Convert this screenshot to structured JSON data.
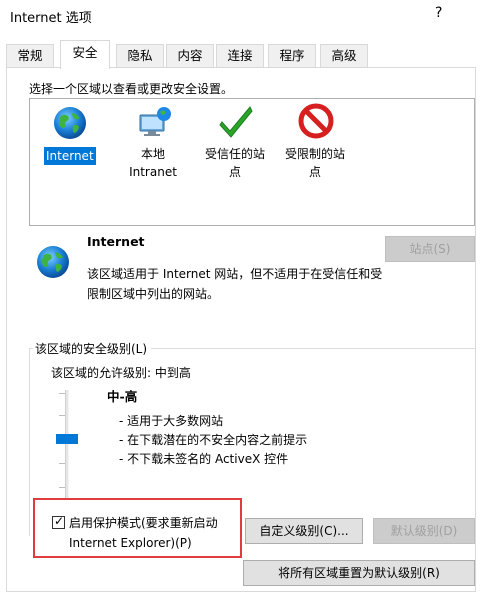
{
  "window": {
    "title": "Internet 选项",
    "help": "?"
  },
  "tabs": [
    {
      "label": "常规"
    },
    {
      "label": "安全"
    },
    {
      "label": "隐私"
    },
    {
      "label": "内容"
    },
    {
      "label": "连接"
    },
    {
      "label": "程序"
    },
    {
      "label": "高级"
    }
  ],
  "active_tab": "安全",
  "security": {
    "zone_prompt": "选择一个区域以查看或更改安全设置。",
    "zones": [
      {
        "label": "Internet",
        "icon": "globe-icon",
        "selected": true
      },
      {
        "label": "本地\nIntranet",
        "icon": "intranet-icon",
        "selected": false
      },
      {
        "label": "受信任的站\n点",
        "icon": "trusted-check-icon",
        "selected": false
      },
      {
        "label": "受限制的站\n点",
        "icon": "restricted-icon",
        "selected": false
      }
    ],
    "selected_zone": {
      "name": "Internet",
      "description": "该区域适用于 Internet 网站，但不适用于在受信任和受限制区域中列出的网站。",
      "sites_button": "站点(S)"
    },
    "level_group": {
      "title": "该区域的安全级别(L)",
      "allowed": "该区域的允许级别: 中到高",
      "level_name": "中-高",
      "bullets": [
        "- 适用于大多数网站",
        "- 在下载潜在的不安全内容之前提示",
        "- 不下载未签名的 ActiveX 控件"
      ],
      "slider_level": 0.5
    },
    "protected_mode": {
      "checked": true,
      "check_mark": "✓",
      "label": "启用保护模式(要求重新启动 Internet Explorer)(P)"
    },
    "buttons": {
      "custom_level": "自定义级别(C)...",
      "default_level": "默认级别(D)",
      "reset_all": "将所有区域重置为默认级别(R)"
    }
  },
  "colors": {
    "selection": "#0078d7",
    "highlight_border": "#e03c3c",
    "trusted_green": "#2aa52a",
    "restricted_red": "#d61f1f"
  }
}
